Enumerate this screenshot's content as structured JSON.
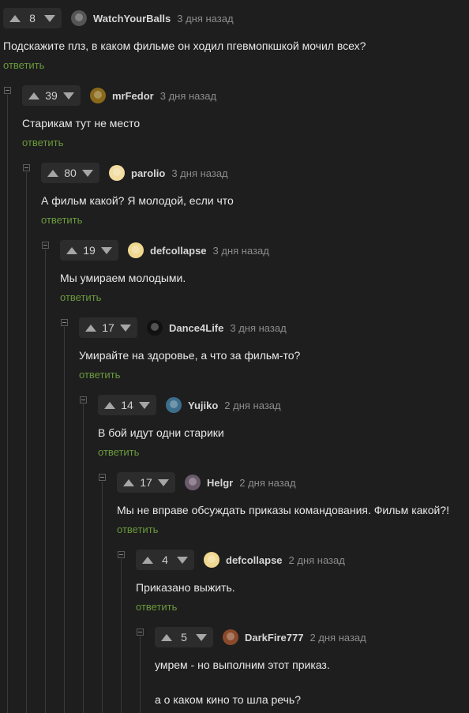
{
  "reply_label": "ответить",
  "comments": [
    {
      "score": "8",
      "user": "WatchYourBalls",
      "time": "3 дня назад",
      "text": "Подскажите плз, в каком фильме он ходил пгевмопкшкой мочил всех?",
      "avatar_color": "#555555"
    },
    {
      "score": "39",
      "user": "mrFedor",
      "time": "3 дня назад",
      "text": "Старикам тут не место",
      "avatar_color": "#8a6a1a"
    },
    {
      "score": "80",
      "user": "parolio",
      "time": "3 дня назад",
      "text": "А фильм какой? Я молодой, если что",
      "avatar_color": "#f2dca0"
    },
    {
      "score": "19",
      "user": "defcollapse",
      "time": "3 дня назад",
      "text": "Мы умираем молодыми.",
      "avatar_color": "#f0d890"
    },
    {
      "score": "17",
      "user": "Dance4Life",
      "time": "3 дня назад",
      "text": "Умирайте на здоровье, а что за фильм-то?",
      "avatar_color": "#111111"
    },
    {
      "score": "14",
      "user": "Yujiko",
      "time": "2 дня назад",
      "text": "В бой идут одни старики",
      "avatar_color": "#3c6e8c"
    },
    {
      "score": "17",
      "user": "Helgr",
      "time": "2 дня назад",
      "text": "Мы не вправе обсуждать приказы командования. Фильм какой?!",
      "avatar_color": "#6a5a6a"
    },
    {
      "score": "4",
      "user": "defcollapse",
      "time": "2 дня назад",
      "text": "Приказано выжить.",
      "avatar_color": "#f0d890"
    },
    {
      "score": "5",
      "user": "DarkFire777",
      "time": "2 дня назад",
      "text": "умрем - но выполним этот приказ.",
      "text2": "а о каком кино то шла речь?",
      "avatar_color": "#8a4a2a"
    }
  ]
}
